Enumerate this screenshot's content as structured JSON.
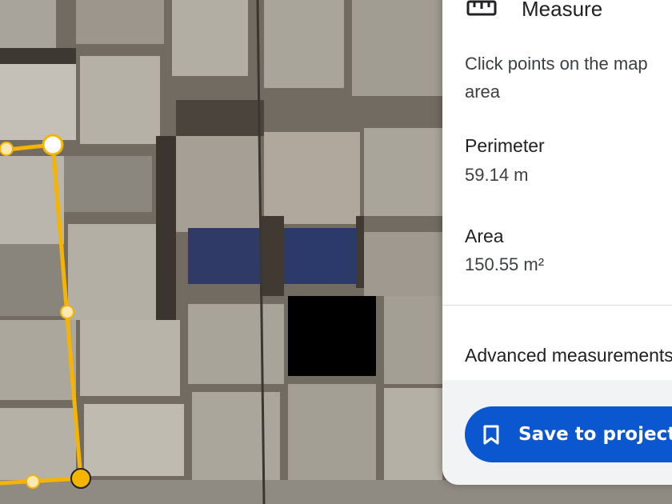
{
  "panel": {
    "icon": "ruler-icon",
    "title": "Measure",
    "description_line1": "Click points on the map",
    "description_line2": "area",
    "perimeter_label": "Perimeter",
    "perimeter_value": "59.14 m",
    "area_label": "Area",
    "area_value": "150.55 m²",
    "advanced_label": "Advanced measurements",
    "save_icon": "bookmark-icon",
    "save_label": "Save to project"
  },
  "colors": {
    "accent": "#0b57d0",
    "measure_line": "#f4b400"
  }
}
